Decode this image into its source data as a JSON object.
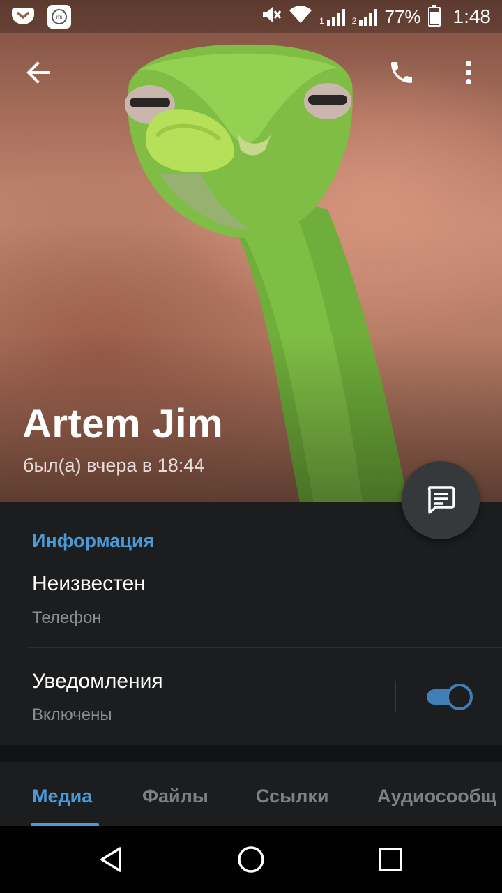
{
  "status_bar": {
    "battery_percent": "77%",
    "time": "1:48",
    "sim1_label": "1",
    "sim2_label": "2",
    "icons": [
      "app-notification-icon",
      "mi-app-icon",
      "mute-icon",
      "wifi-icon",
      "signal-icon",
      "battery-icon"
    ]
  },
  "toolbar": {
    "back_icon": "arrow-left-icon",
    "call_icon": "phone-icon",
    "more_icon": "more-vertical-icon"
  },
  "profile": {
    "name": "Artem Jim",
    "last_seen": "был(а) вчера в 18:44"
  },
  "fab": {
    "icon": "message-icon"
  },
  "info": {
    "heading": "Информация",
    "phone_value": "Неизвестен",
    "phone_label": "Телефон",
    "notifications_title": "Уведомления",
    "notifications_state": "Включены",
    "notifications_enabled": true
  },
  "tabs": [
    {
      "label": "Медиа",
      "active": true
    },
    {
      "label": "Файлы",
      "active": false
    },
    {
      "label": "Ссылки",
      "active": false
    },
    {
      "label": "Аудиосообщ",
      "active": false
    }
  ],
  "colors": {
    "accent": "#4a9ad8",
    "panel": "#1c1d1f",
    "toggle": "#3f7fb6"
  },
  "nav": {
    "icons": [
      "back-triangle-icon",
      "home-circle-icon",
      "recents-square-icon"
    ]
  }
}
